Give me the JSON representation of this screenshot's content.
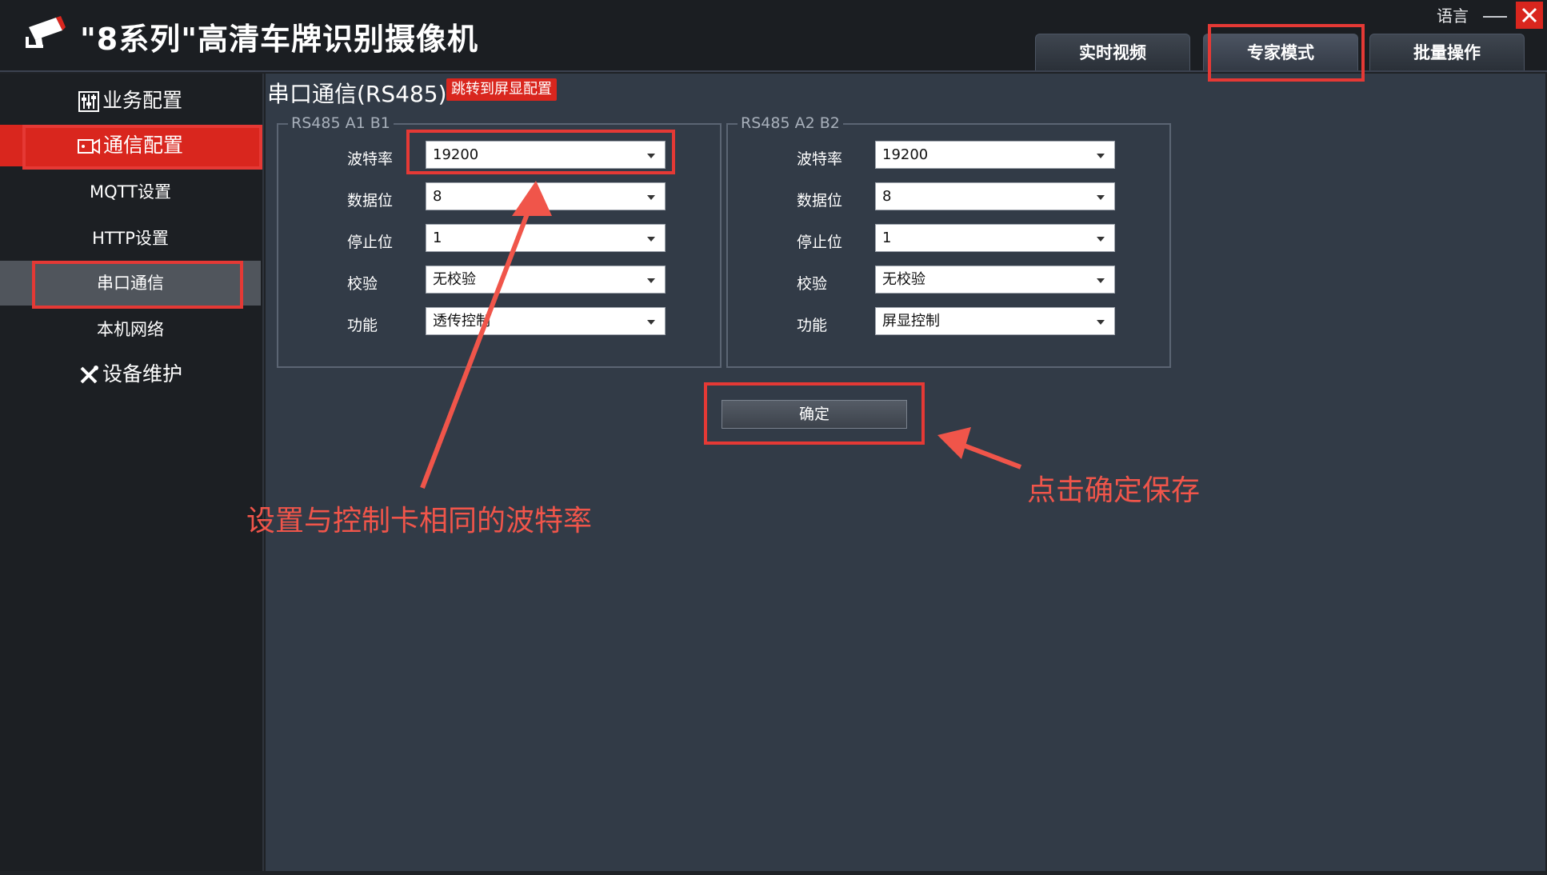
{
  "app": {
    "title": "\"8系列\"高清车牌识别摄像机",
    "language_label": "语言"
  },
  "tabs": [
    {
      "label": "实时视频",
      "active": false
    },
    {
      "label": "专家模式",
      "active": true
    },
    {
      "label": "批量操作",
      "active": false
    }
  ],
  "sidebar": {
    "items": [
      {
        "label": "业务配置",
        "icon": "sliders-icon"
      },
      {
        "label": "通信配置",
        "icon": "camera-icon",
        "active": true
      },
      {
        "label": "MQTT设置"
      },
      {
        "label": "HTTP设置"
      },
      {
        "label": "串口通信",
        "selected": true
      },
      {
        "label": "本机网络"
      },
      {
        "label": "设备维护",
        "icon": "tools-icon"
      }
    ]
  },
  "main": {
    "title": "串口通信(RS485)",
    "jump_button": "跳转到屏显配置",
    "groups": [
      {
        "legend": "RS485  A1 B1",
        "fields": [
          {
            "label": "波特率",
            "value": "19200"
          },
          {
            "label": "数据位",
            "value": "8"
          },
          {
            "label": "停止位",
            "value": "1"
          },
          {
            "label": "校验",
            "value": "无校验"
          },
          {
            "label": "功能",
            "value": "透传控制"
          }
        ]
      },
      {
        "legend": "RS485  A2 B2",
        "fields": [
          {
            "label": "波特率",
            "value": "19200"
          },
          {
            "label": "数据位",
            "value": "8"
          },
          {
            "label": "停止位",
            "value": "1"
          },
          {
            "label": "校验",
            "value": "无校验"
          },
          {
            "label": "功能",
            "value": "屏显控制"
          }
        ]
      }
    ],
    "confirm_button": "确定"
  },
  "annotations": {
    "baud_note": "设置与控制卡相同的波特率",
    "save_note": "点击确定保存",
    "color": "#e53935"
  },
  "colors": {
    "accent_red": "#d9261e",
    "panel_bg": "#323b47",
    "sidebar_bg": "#1c1f23"
  }
}
